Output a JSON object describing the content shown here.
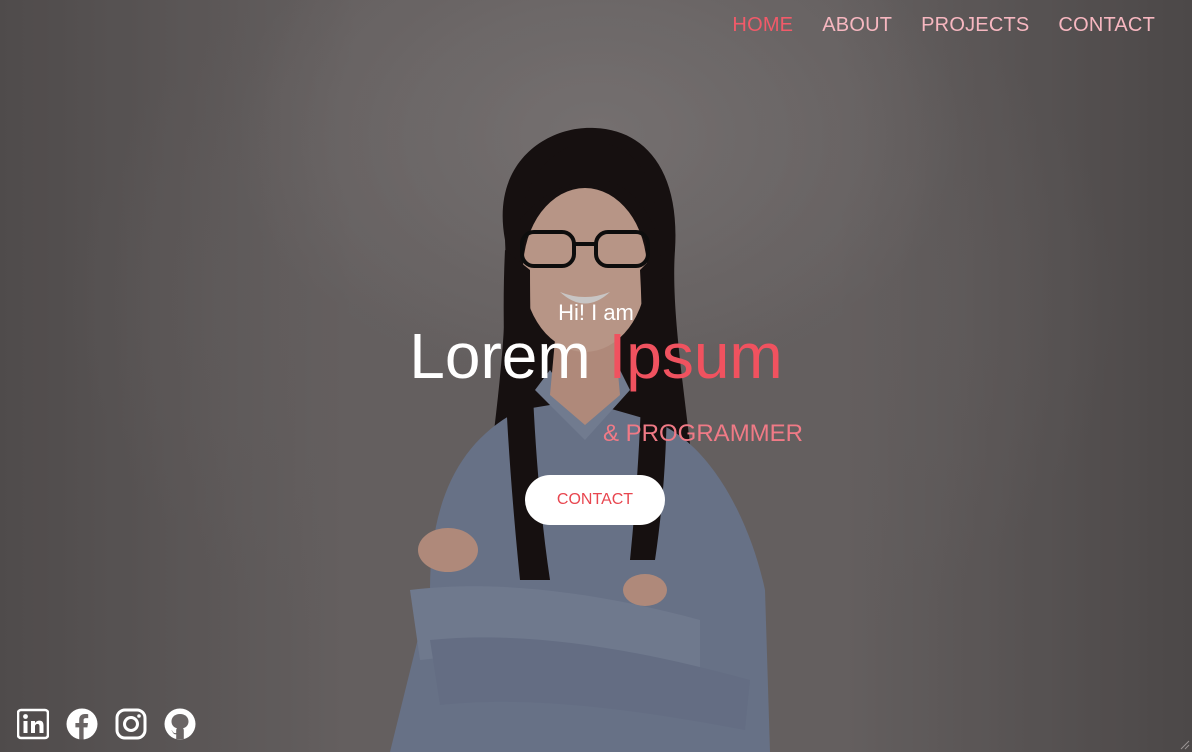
{
  "nav": {
    "items": [
      {
        "label": "HOME",
        "active": true
      },
      {
        "label": "ABOUT"
      },
      {
        "label": "PROJECTS"
      },
      {
        "label": "CONTACT"
      }
    ]
  },
  "hero": {
    "greeting": "Hi! I am",
    "first_name": "Lorem",
    "last_name": "Ipsum",
    "role": "& PROGRAMMER",
    "cta_label": "CONTACT"
  },
  "social": {
    "icons": [
      "linkedin-icon",
      "facebook-icon",
      "instagram-icon",
      "github-icon"
    ]
  },
  "colors": {
    "accent": "#f0525f",
    "nav_text": "#f7b7c0",
    "nav_active": "#f25a69",
    "role_text": "#f07a86",
    "button_bg": "#ffffff"
  }
}
